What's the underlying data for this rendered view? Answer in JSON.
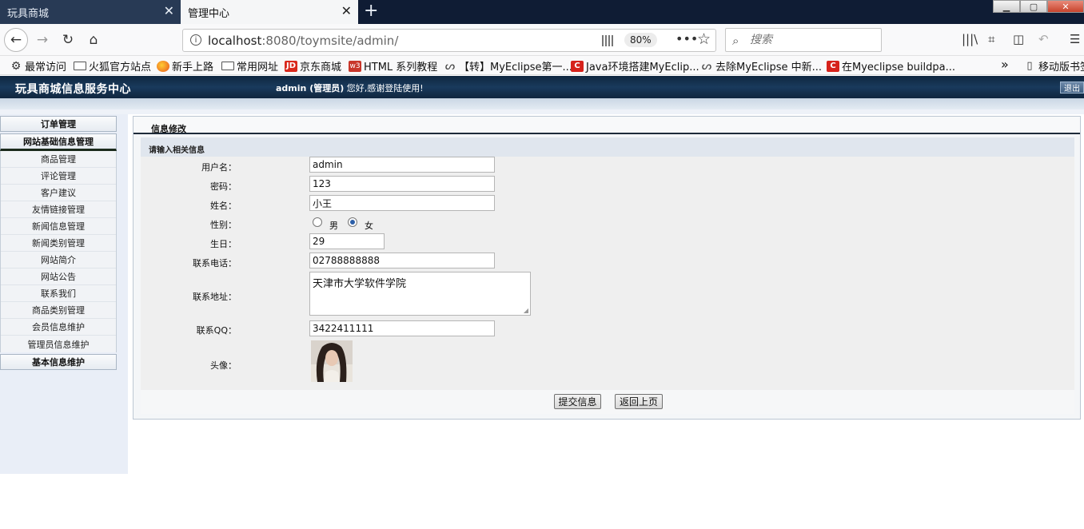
{
  "browser": {
    "tabs": [
      {
        "title": "玩具商城"
      },
      {
        "title": "管理中心"
      }
    ],
    "url_host": "localhost",
    "url_rest": ":8080/toymsite/admin/",
    "zoom": "80%",
    "search_placeholder": "搜索",
    "bookmarks": [
      {
        "label": "最常访问",
        "icon": "gear-icon"
      },
      {
        "label": "火狐官方站点",
        "icon": "folder-icon"
      },
      {
        "label": "新手上路",
        "icon": "firefox-icon"
      },
      {
        "label": "常用网址",
        "icon": "folder-icon"
      },
      {
        "label": "京东商城",
        "icon": "jd-icon"
      },
      {
        "label": "HTML 系列教程",
        "icon": "w3-icon"
      },
      {
        "label": "【转】MyEclipse第一...",
        "icon": "loop-icon"
      },
      {
        "label": "Java环境搭建MyEclip...",
        "icon": "c-icon"
      },
      {
        "label": "去除MyEclipse 中新...",
        "icon": "loop-icon"
      },
      {
        "label": "在Myeclipse buildpa...",
        "icon": "c-icon"
      }
    ],
    "overflow_label": "»",
    "mobile_bookmarks": "移动版书签"
  },
  "header": {
    "site_title": "玩具商城信息服务中心",
    "welcome_user": "admin (管理员)",
    "welcome_text": "您好,感谢登陆使用!",
    "logout": "退出"
  },
  "sidebar": {
    "sections": [
      {
        "title": "订单管理"
      },
      {
        "title": "网站基础信息管理"
      },
      {
        "title": "基本信息维护"
      }
    ],
    "items": [
      {
        "label": "商品管理"
      },
      {
        "label": "评论管理"
      },
      {
        "label": "客户建议"
      },
      {
        "label": "友情链接管理"
      },
      {
        "label": "新闻信息管理"
      },
      {
        "label": "新闻类别管理"
      },
      {
        "label": "网站简介"
      },
      {
        "label": "网站公告"
      },
      {
        "label": "联系我们"
      },
      {
        "label": "商品类别管理"
      },
      {
        "label": "会员信息维护"
      },
      {
        "label": "管理员信息维护"
      }
    ]
  },
  "main": {
    "panel_title": "信息修改",
    "panel_subtitle": "请输入相关信息",
    "fields": {
      "username": {
        "label": "用户名：",
        "value": "admin"
      },
      "password": {
        "label": "密码：",
        "value": "123"
      },
      "name": {
        "label": "姓名：",
        "value": "小王"
      },
      "gender": {
        "label": "性别：",
        "male": "男",
        "female": "女",
        "selected": "女"
      },
      "birthday": {
        "label": "生日：",
        "value": "29"
      },
      "phone": {
        "label": "联系电话：",
        "value": "02788888888"
      },
      "address": {
        "label": "联系地址：",
        "value": "天津市大学软件学院"
      },
      "qq": {
        "label": "联系QQ：",
        "value": "3422411111"
      },
      "avatar": {
        "label": "头像："
      }
    },
    "submit": "提交信息",
    "back": "返回上页"
  }
}
